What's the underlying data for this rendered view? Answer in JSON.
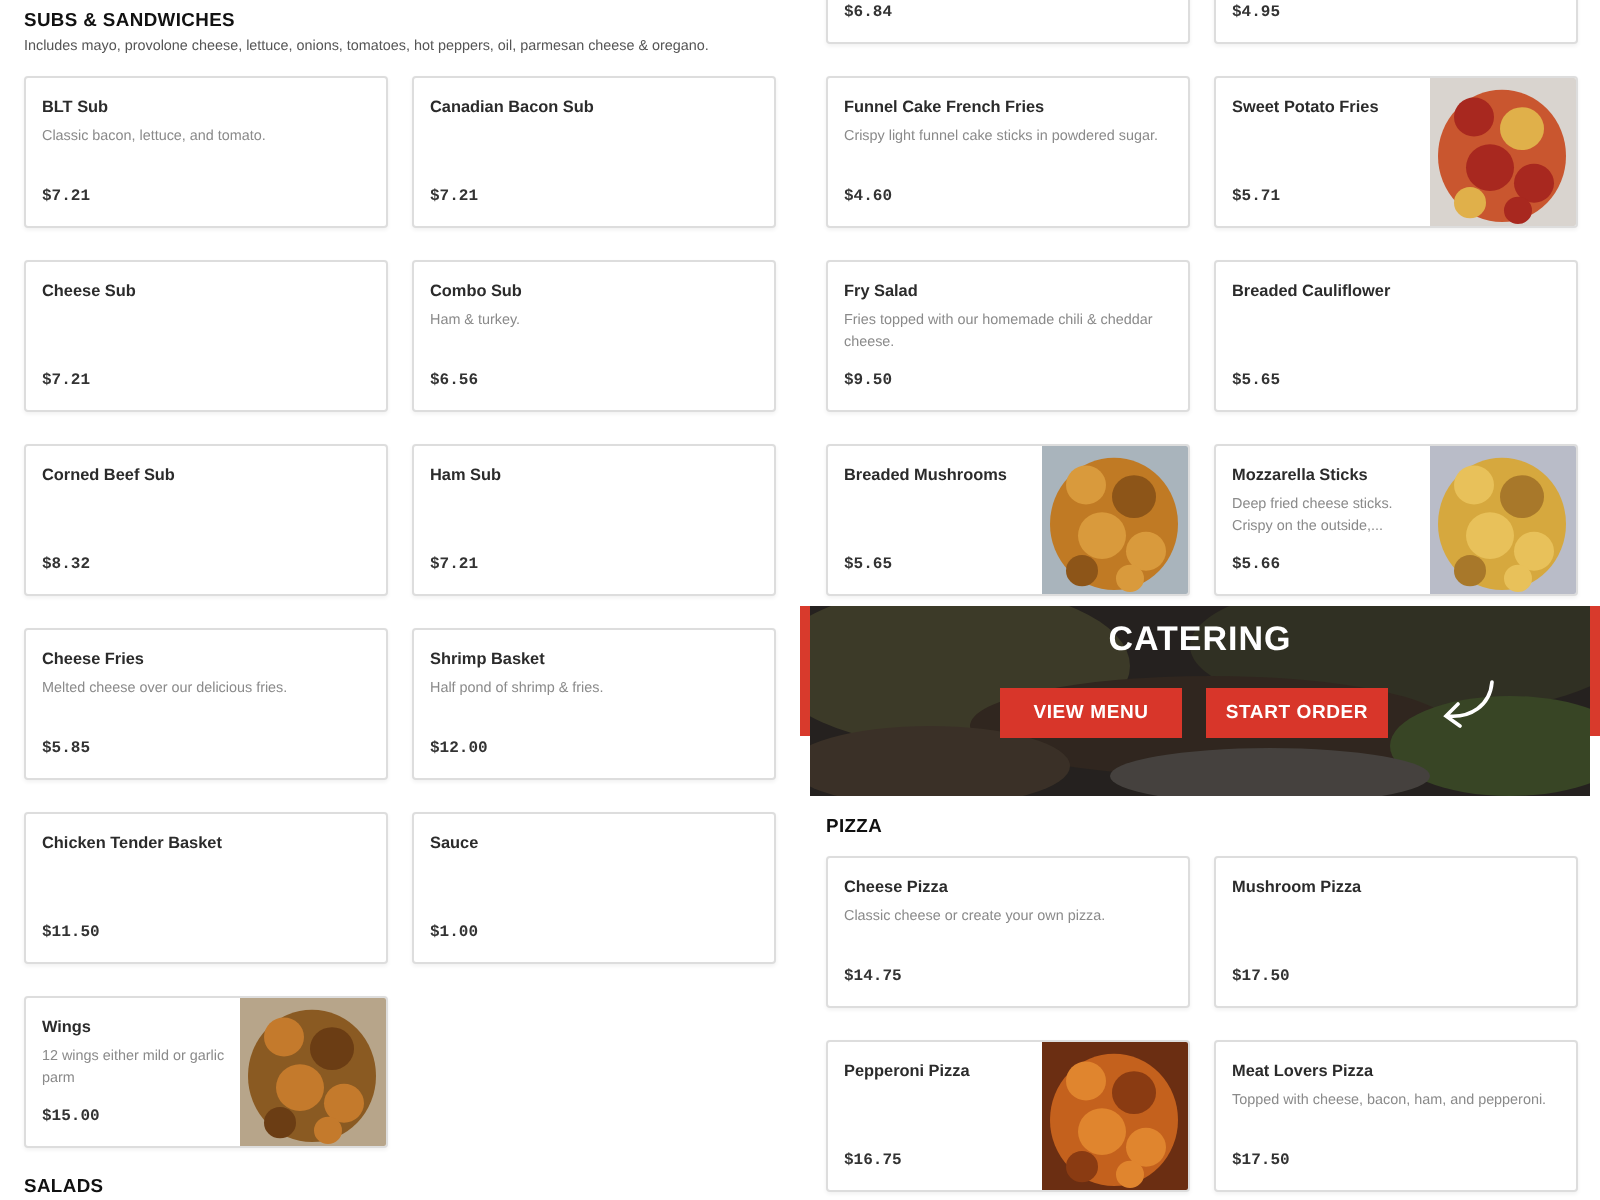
{
  "left_column": [
    {
      "heading": "SUBS & SANDWICHES",
      "note": "Includes mayo, provolone cheese, lettuce, onions, tomatoes, hot peppers, oil, parmesan cheese & oregano.",
      "items": [
        {
          "name": "BLT Sub",
          "description": "Classic bacon, lettuce, and tomato.",
          "price": "$7.21"
        },
        {
          "name": "Canadian Bacon Sub",
          "price": "$7.21"
        },
        {
          "name": "Cheese Sub",
          "price": "$7.21"
        },
        {
          "name": "Combo Sub",
          "description": "Ham & turkey.",
          "price": "$6.56"
        },
        {
          "name": "Corned Beef Sub",
          "price": "$8.32"
        },
        {
          "name": "Ham Sub",
          "price": "$7.21"
        },
        {
          "name": "Cheese Fries",
          "description": "Melted cheese over our delicious fries.",
          "price": "$5.85"
        },
        {
          "name": "Shrimp Basket",
          "description": "Half pond of shrimp & fries.",
          "price": "$12.00"
        },
        {
          "name": "Chicken Tender Basket",
          "price": "$11.50"
        },
        {
          "name": "Sauce",
          "price": "$1.00"
        },
        {
          "name": "Wings",
          "description": "12 wings either mild or garlic parm",
          "price": "$15.00"
        }
      ]
    },
    {
      "heading": "SALADS"
    }
  ],
  "right_column": {
    "items": [
      {
        "price": "$6.84"
      },
      {
        "price": "$4.95"
      },
      {
        "name": "Funnel Cake French Fries",
        "description": "Crispy light funnel cake sticks in powdered sugar.",
        "price": "$4.60"
      },
      {
        "name": "Sweet Potato Fries",
        "price": "$5.71"
      },
      {
        "name": "Fry Salad",
        "description": "Fries topped with our homemade chili & cheddar cheese.",
        "price": "$9.50"
      },
      {
        "name": "Breaded Cauliflower",
        "price": "$5.65"
      },
      {
        "name": "Breaded Mushrooms",
        "price": "$5.65"
      },
      {
        "name": "Mozzarella Sticks",
        "description": "Deep fried cheese sticks. Crispy on the outside,...",
        "price": "$5.66"
      }
    ],
    "banner": {
      "title": "CATERING",
      "buttons": [
        "VIEW MENU",
        "START ORDER"
      ]
    },
    "sections": [
      {
        "heading": "PIZZA",
        "items": [
          {
            "name": "Cheese Pizza",
            "description": "Classic cheese or create your own pizza.",
            "price": "$14.75"
          },
          {
            "name": "Mushroom Pizza",
            "price": "$17.50"
          },
          {
            "name": "Pepperoni Pizza",
            "price": "$16.75"
          },
          {
            "name": "Meat Lovers Pizza",
            "description": "Topped with cheese, bacon, ham, and pepperoni.",
            "price": "$17.50"
          }
        ]
      }
    ]
  }
}
